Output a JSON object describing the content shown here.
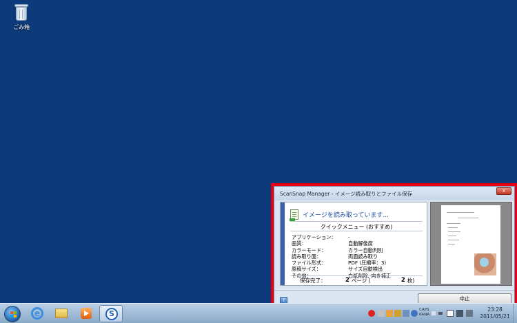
{
  "desktop": {
    "recycle_bin_label": "ごみ箱"
  },
  "window": {
    "title": "ScanSnap Manager - イメージ読み取りとファイル保存",
    "close_label": "x",
    "status_text": "イメージを読み取っています...",
    "quick_menu_title": "クイックメニュー (おすすめ)",
    "settings": [
      {
        "label": "アプリケーション：",
        "value": "-"
      },
      {
        "label": "画質：",
        "value": "自動解像度"
      },
      {
        "label": "カラーモード：",
        "value": "カラー自動判別"
      },
      {
        "label": "読み取り面：",
        "value": "両面読み取り"
      },
      {
        "label": "ファイル形式：",
        "value": "PDF (圧縮率：3)"
      },
      {
        "label": "原稿サイズ：",
        "value": "サイズ自動検出"
      },
      {
        "label": "その他：",
        "value": "白紙削除, 向き補正"
      }
    ],
    "saved": {
      "label": "保存完了：",
      "pages": "2",
      "pages_unit": "ページ (",
      "sheets": "2",
      "sheets_unit": "枚)"
    },
    "help_label": "?",
    "cancel_label": "中止"
  },
  "taskbar": {
    "ime_line1": "CAPS",
    "ime_line2": "KANA",
    "time": "23:28",
    "date": "2011/05/21"
  },
  "colors": {
    "desktop_bg": "#0c3a7a",
    "highlight": "#e60012",
    "accent": "#3b5fa8",
    "status_text": "#1e4fa0"
  }
}
